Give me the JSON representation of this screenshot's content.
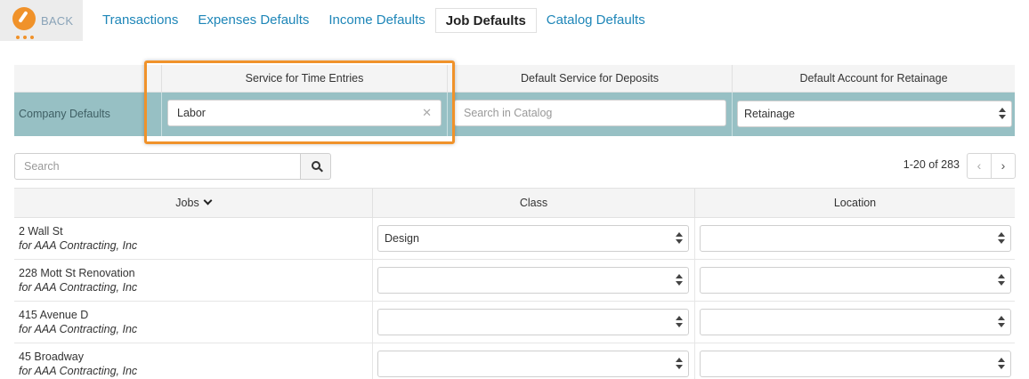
{
  "nav": {
    "back_label": "BACK",
    "tabs": [
      {
        "label": "Transactions",
        "active": false
      },
      {
        "label": "Expenses Defaults",
        "active": false
      },
      {
        "label": "Income Defaults",
        "active": false
      },
      {
        "label": "Job Defaults",
        "active": true
      },
      {
        "label": "Catalog Defaults",
        "active": false
      }
    ]
  },
  "company_defaults": {
    "row_label": "Company Defaults",
    "columns": {
      "service_time": "Service for Time Entries",
      "service_deposits": "Default Service for Deposits",
      "account_retainage": "Default Account for Retainage"
    },
    "service_time_value": "Labor",
    "service_deposits_placeholder": "Search in Catalog",
    "account_retainage_value": "Retainage"
  },
  "search": {
    "placeholder": "Search"
  },
  "pagination": {
    "summary": "1-20 of 283",
    "prev": "‹",
    "next": "›"
  },
  "jobs_table": {
    "headers": {
      "jobs": "Jobs",
      "class": "Class",
      "location": "Location"
    },
    "rows": [
      {
        "name": "2 Wall St",
        "customer": "for AAA Contracting, Inc",
        "class": "Design",
        "location": ""
      },
      {
        "name": "228 Mott St Renovation",
        "customer": "for AAA Contracting, Inc",
        "class": "",
        "location": ""
      },
      {
        "name": "415 Avenue D",
        "customer": "for AAA Contracting, Inc",
        "class": "",
        "location": ""
      },
      {
        "name": "45 Broadway",
        "customer": "for AAA Contracting, Inc",
        "class": "",
        "location": ""
      }
    ]
  },
  "colors": {
    "accent": "#f0922a",
    "link": "#1e86b8",
    "defaults_row": "#97c0c4"
  },
  "icons": {
    "back": "gauge-logo-icon",
    "search": "search-icon",
    "sort": "chevron-down-icon",
    "clear": "clear-x-icon",
    "select": "select-arrows-icon"
  }
}
